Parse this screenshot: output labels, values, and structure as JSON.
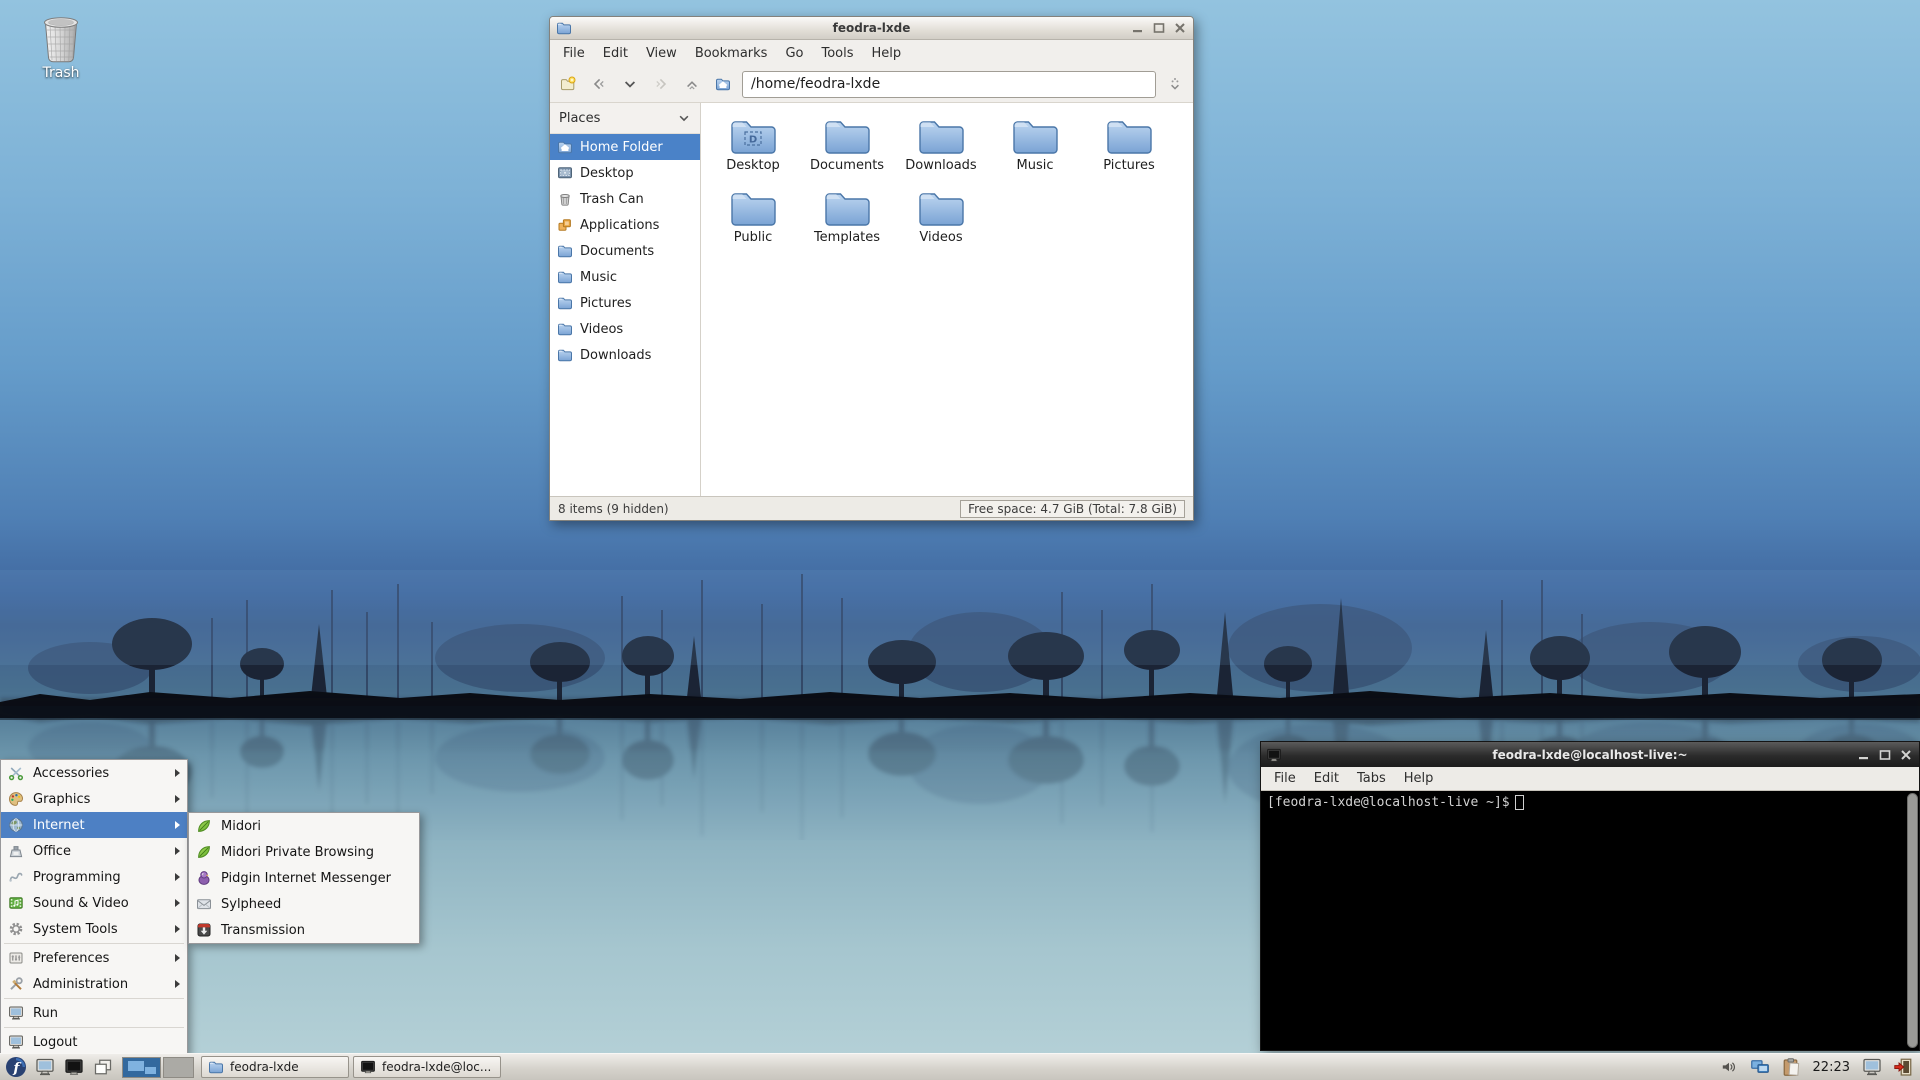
{
  "colors": {
    "selection_blue": "#4a82c8",
    "menu_highlight": "#4d80c4",
    "folder_blue": "#7fa8d6",
    "taskbar_bg": "#d6d3cc",
    "terminal_bg": "#000000",
    "sky_top": "#93c3df",
    "water_bottom": "#b7d2d8"
  },
  "desktop": {
    "trash": {
      "label": "Trash",
      "icon": "trash-icon"
    }
  },
  "file_manager": {
    "title": "feodra-lxde",
    "title_icon": "folder-icon",
    "window_controls": {
      "minimize": "minimize-icon",
      "maximize": "maximize-icon",
      "close": "close-icon"
    },
    "menubar": [
      "File",
      "Edit",
      "View",
      "Bookmarks",
      "Go",
      "Tools",
      "Help"
    ],
    "toolbar": {
      "buttons": [
        "new-tab-icon",
        "back-icon",
        "history-dropdown-icon",
        "forward-icon",
        "up-icon",
        "home-icon"
      ],
      "address_value": "/home/feodra-lxde",
      "right_button": "jump-to-icon"
    },
    "places": {
      "header": "Places",
      "items": [
        {
          "label": "Home Folder",
          "icon": "home-folder-icon",
          "selected": true
        },
        {
          "label": "Desktop",
          "icon": "desktop-icon",
          "selected": false
        },
        {
          "label": "Trash Can",
          "icon": "trash-icon",
          "selected": false
        },
        {
          "label": "Applications",
          "icon": "applications-icon",
          "selected": false
        },
        {
          "label": "Documents",
          "icon": "folder-icon",
          "selected": false
        },
        {
          "label": "Music",
          "icon": "folder-icon",
          "selected": false
        },
        {
          "label": "Pictures",
          "icon": "folder-icon",
          "selected": false
        },
        {
          "label": "Videos",
          "icon": "folder-icon",
          "selected": false
        },
        {
          "label": "Downloads",
          "icon": "folder-icon",
          "selected": false
        }
      ]
    },
    "folders": [
      "Desktop",
      "Documents",
      "Downloads",
      "Music",
      "Pictures",
      "Public",
      "Templates",
      "Videos"
    ],
    "statusbar": {
      "left": "8 items (9 hidden)",
      "right": "Free space: 4.7 GiB (Total: 7.8 GiB)"
    }
  },
  "terminal": {
    "title": "feodra-lxde@localhost-live:~",
    "title_icon": "terminal-icon",
    "window_controls": {
      "minimize": "minimize-icon",
      "maximize": "maximize-icon",
      "close": "close-icon"
    },
    "menubar": [
      "File",
      "Edit",
      "Tabs",
      "Help"
    ],
    "prompt": "[feodra-lxde@localhost-live ~]$"
  },
  "app_menu": {
    "items": [
      {
        "label": "Accessories",
        "icon": "scissors-icon",
        "has_submenu": true,
        "highlighted": false
      },
      {
        "label": "Graphics",
        "icon": "palette-icon",
        "has_submenu": true,
        "highlighted": false
      },
      {
        "label": "Internet",
        "icon": "globe-icon",
        "has_submenu": true,
        "highlighted": true
      },
      {
        "label": "Office",
        "icon": "office-icon",
        "has_submenu": true,
        "highlighted": false
      },
      {
        "label": "Programming",
        "icon": "programming-icon",
        "has_submenu": true,
        "highlighted": false
      },
      {
        "label": "Sound & Video",
        "icon": "media-icon",
        "has_submenu": true,
        "highlighted": false
      },
      {
        "label": "System Tools",
        "icon": "gear-icon",
        "has_submenu": true,
        "highlighted": false
      },
      {
        "label": "Preferences",
        "icon": "preferences-icon",
        "has_submenu": true,
        "highlighted": false
      },
      {
        "label": "Administration",
        "icon": "admin-icon",
        "has_submenu": true,
        "highlighted": false
      },
      {
        "label": "Run",
        "icon": "monitor-icon",
        "has_submenu": false,
        "highlighted": false
      },
      {
        "label": "Logout",
        "icon": "monitor-icon",
        "has_submenu": false,
        "highlighted": false
      }
    ],
    "internet_submenu": [
      {
        "label": "Midori",
        "icon": "leaf-icon"
      },
      {
        "label": "Midori Private Browsing",
        "icon": "leaf-icon"
      },
      {
        "label": "Pidgin Internet Messenger",
        "icon": "pidgin-icon"
      },
      {
        "label": "Sylpheed",
        "icon": "envelope-icon"
      },
      {
        "label": "Transmission",
        "icon": "transmission-icon"
      }
    ]
  },
  "taskbar": {
    "start_icon": "fedora-logo-icon",
    "launchers": [
      "desktop-monitor-icon",
      "terminal-screen-icon",
      "iconify-all-icon"
    ],
    "pager": {
      "workspaces": 2,
      "active": 1
    },
    "tasks": [
      {
        "label": "feodra-lxde",
        "icon": "folder-icon"
      },
      {
        "label": "feodra-lxde@loc...",
        "icon": "terminal-screen-icon"
      }
    ],
    "tray_icons": [
      "volume-icon",
      "network-icon",
      "clipboard-icon"
    ],
    "clock": "22:23",
    "right_icons": [
      "screensaver-monitor-icon",
      "logout-door-icon"
    ]
  }
}
